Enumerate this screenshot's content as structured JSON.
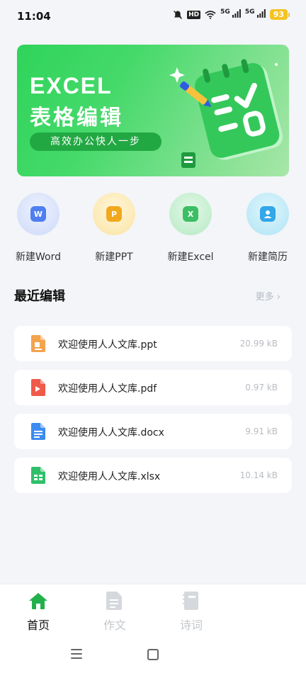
{
  "status": {
    "time": "11:04",
    "battery": "93",
    "hd": "HD",
    "net1": "5G",
    "net2": "5G"
  },
  "banner": {
    "title_line1": "EXCEL",
    "title_line2": "表格编辑",
    "slogan": "高效办公快人一步"
  },
  "actions": [
    {
      "label": "新建Word",
      "icon": "word-icon",
      "glyph": "W",
      "tile_color": "#4f7ff0",
      "bg": "#dde6fb"
    },
    {
      "label": "新建PPT",
      "icon": "ppt-icon",
      "glyph": "P",
      "tile_color": "#f2a81d",
      "bg": "#fbefc9"
    },
    {
      "label": "新建Excel",
      "icon": "excel-icon",
      "glyph": "X",
      "tile_color": "#3cbf64",
      "bg": "#cdf0d6"
    },
    {
      "label": "新建简历",
      "icon": "resume-icon",
      "glyph": "",
      "tile_color": "#33a7e8",
      "bg": "#c9ecf7"
    }
  ],
  "recent": {
    "title": "最近编辑",
    "more": "更多 ›"
  },
  "files": [
    {
      "name": "欢迎使用人人文库.ppt",
      "size": "20.99 kB",
      "type": "ppt",
      "color": "#f4a24c"
    },
    {
      "name": "欢迎使用人人文库.pdf",
      "size": "0.97 kB",
      "type": "pdf",
      "color": "#ef5a4a"
    },
    {
      "name": "欢迎使用人人文库.docx",
      "size": "9.91 kB",
      "type": "doc",
      "color": "#3d8bf0"
    },
    {
      "name": "欢迎使用人人文库.xlsx",
      "size": "10.14 kB",
      "type": "xls",
      "color": "#2fbf6a"
    }
  ],
  "nav": [
    {
      "label": "首页",
      "icon": "home-icon",
      "active": true
    },
    {
      "label": "作文",
      "icon": "document-icon",
      "active": false
    },
    {
      "label": "诗词",
      "icon": "book-icon",
      "active": false
    }
  ]
}
